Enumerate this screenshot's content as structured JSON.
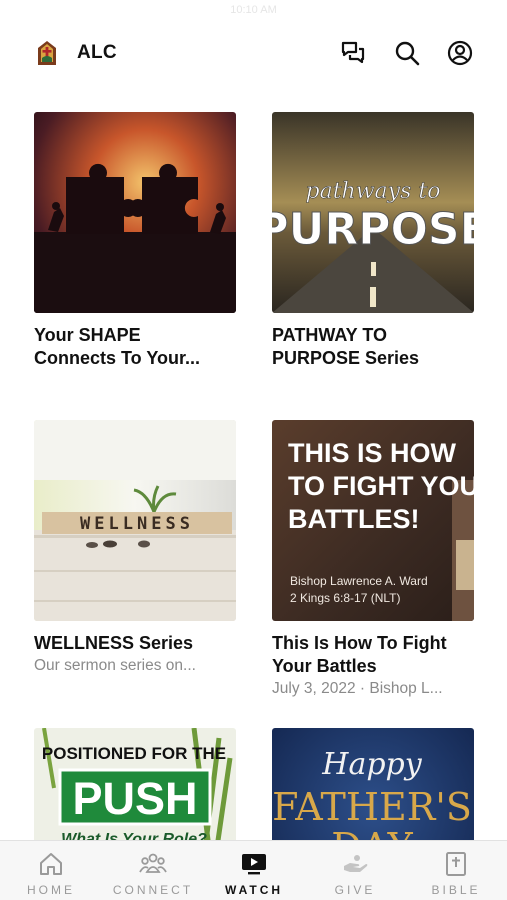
{
  "status": {
    "time": "10:10 AM"
  },
  "header": {
    "title": "ALC",
    "icons": [
      "church-logo-icon",
      "chat-icon",
      "search-icon",
      "account-icon"
    ]
  },
  "cards": [
    {
      "title": "Your SHAPE\nConnects To Your...",
      "subtitle": ""
    },
    {
      "title": "PATHWAY TO\nPURPOSE Series",
      "subtitle": "",
      "thumb_text": {
        "script": "pathways to",
        "big": "PURPOSE"
      }
    },
    {
      "title": "WELLNESS Series",
      "subtitle": "Our sermon series on...",
      "thumb_text": {
        "blocks": "WELLNESS"
      }
    },
    {
      "title": "This Is How To Fight\nYour Battles",
      "subtitle": "July 3, 2022 · Bishop L...",
      "thumb_text": {
        "line1": "THIS IS HOW",
        "line2": "TO FIGHT YOUR",
        "line3": "BATTLES!",
        "speaker": "Bishop Lawrence A. Ward",
        "scripture": "2 Kings 6:8-17 (NLT)"
      }
    },
    {
      "title": "",
      "subtitle": "",
      "thumb_text": {
        "top": "POSITIONED FOR THE",
        "big": "PUSH",
        "bottom": "What Is Your Role?"
      }
    },
    {
      "title": "",
      "subtitle": "",
      "thumb_text": {
        "script": "Happy",
        "big1": "FATHER'S",
        "big2": "DAY"
      }
    }
  ],
  "tabs": [
    {
      "label": "HOME",
      "icon": "home-icon",
      "active": false
    },
    {
      "label": "CONNECT",
      "icon": "people-icon",
      "active": false
    },
    {
      "label": "WATCH",
      "icon": "tv-play-icon",
      "active": true
    },
    {
      "label": "GIVE",
      "icon": "give-hand-icon",
      "active": false
    },
    {
      "label": "BIBLE",
      "icon": "bible-icon",
      "active": false
    }
  ],
  "colors": {
    "accent": "#111111",
    "inactive": "#9a9a9a",
    "tabbar_bg": "#f7f7f7"
  }
}
